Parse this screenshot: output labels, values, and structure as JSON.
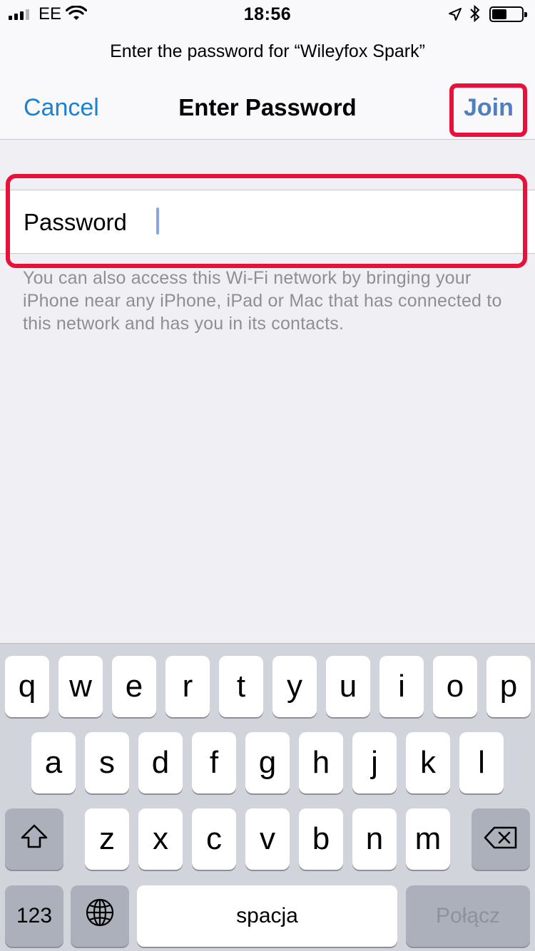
{
  "status_bar": {
    "carrier": "EE",
    "time": "18:56",
    "icons": [
      "signal-icon",
      "wifi-icon",
      "location-icon",
      "bluetooth-icon",
      "battery-icon"
    ],
    "battery_level": 0.45
  },
  "prompt": "Enter the password for “Wileyfox Spark”",
  "nav": {
    "cancel_label": "Cancel",
    "title": "Enter Password",
    "join_label": "Join"
  },
  "password_field": {
    "label": "Password",
    "value": ""
  },
  "hint": "You can also access this Wi-Fi network by bringing your iPhone near any iPhone, iPad or Mac that has connected to this network and has you in its contacts.",
  "keyboard": {
    "row1": [
      "q",
      "w",
      "e",
      "r",
      "t",
      "y",
      "u",
      "i",
      "o",
      "p"
    ],
    "row2": [
      "a",
      "s",
      "d",
      "f",
      "g",
      "h",
      "j",
      "k",
      "l"
    ],
    "row3": [
      "z",
      "x",
      "c",
      "v",
      "b",
      "n",
      "m"
    ],
    "numbers_label": "123",
    "space_label": "spacja",
    "return_label": "Połącz",
    "icons": [
      "shift-icon",
      "backspace-icon",
      "globe-icon"
    ]
  },
  "colors": {
    "accent": "#1a82d4",
    "highlight": "#e8113a",
    "background": "#efeff4",
    "keyboard": "#d1d4da"
  }
}
